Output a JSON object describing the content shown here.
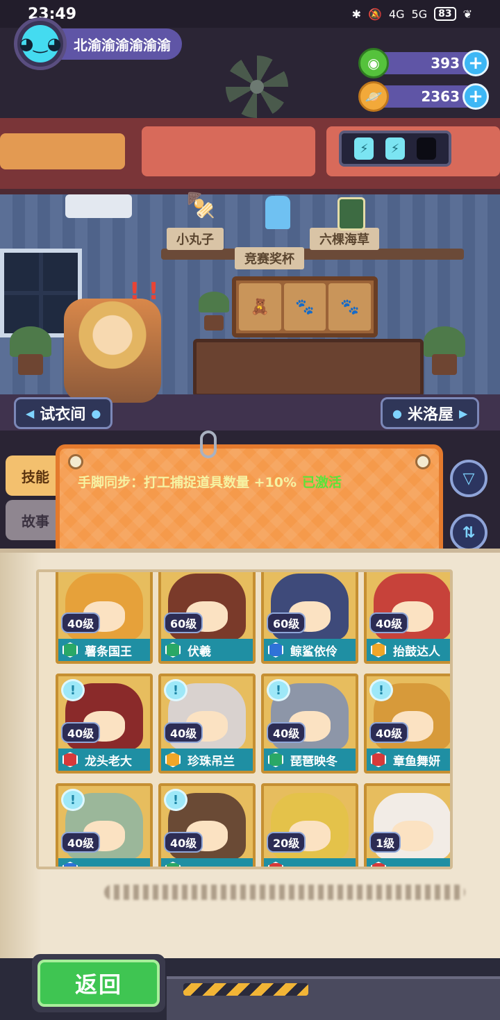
{
  "status_bar": {
    "time": "23:49",
    "signal_1": "4G",
    "signal_2": "5G",
    "battery": "83"
  },
  "player": {
    "name": "北渝渝渝渝渝渝"
  },
  "currencies": [
    {
      "name": "green-gem",
      "amount": "393",
      "color": "#55c23c"
    },
    {
      "name": "gold-planet",
      "amount": "2363",
      "color": "#f2a93a"
    }
  ],
  "energy": {
    "filled": 2,
    "total": 3
  },
  "room": {
    "shelf_item_left": "小丸子",
    "shelf_item_right": "六棵海草",
    "trophy_label": "竞赛奖杯",
    "left_nav": "试衣间",
    "right_nav": "米洛屋"
  },
  "tabs": {
    "skill": "技能",
    "story": "故事"
  },
  "skill": {
    "text": "手脚同步：打工捕捉道具数量 +10%",
    "status": "已激活"
  },
  "characters": [
    {
      "level": "40级",
      "name": "薯条国王",
      "rarity": "green",
      "bubble": false,
      "hair": "#e6a13a"
    },
    {
      "level": "60级",
      "name": "伏羲",
      "rarity": "green",
      "bubble": false,
      "hair": "#7a3a2a"
    },
    {
      "level": "60级",
      "name": "鲸鲨依伶",
      "rarity": "blue",
      "bubble": false,
      "hair": "#3e4a7a"
    },
    {
      "level": "40级",
      "name": "抬鼓达人",
      "rarity": "gold",
      "bubble": false,
      "hair": "#c7423a"
    },
    {
      "level": "40级",
      "name": "龙头老大",
      "rarity": "red",
      "bubble": true,
      "hair": "#8a2a2a"
    },
    {
      "level": "40级",
      "name": "珍珠吊兰",
      "rarity": "gold",
      "bubble": true,
      "hair": "#d9d2cf"
    },
    {
      "level": "40级",
      "name": "琵琶映冬",
      "rarity": "green",
      "bubble": true,
      "hair": "#8d96a8"
    },
    {
      "level": "40级",
      "name": "章鱼舞妍",
      "rarity": "red",
      "bubble": true,
      "hair": "#d79a3a"
    },
    {
      "level": "40级",
      "name": "",
      "rarity": "blue",
      "bubble": true,
      "hair": "#9bb79a"
    },
    {
      "level": "40级",
      "name": "",
      "rarity": "green",
      "bubble": true,
      "hair": "#6a4a35"
    },
    {
      "level": "20级",
      "name": "",
      "rarity": "red",
      "bubble": false,
      "hair": "#e4c24a"
    },
    {
      "level": "1级",
      "name": "",
      "rarity": "red",
      "bubble": false,
      "hair": "#f2ece6"
    }
  ],
  "bottom": {
    "back_label": "返回"
  }
}
